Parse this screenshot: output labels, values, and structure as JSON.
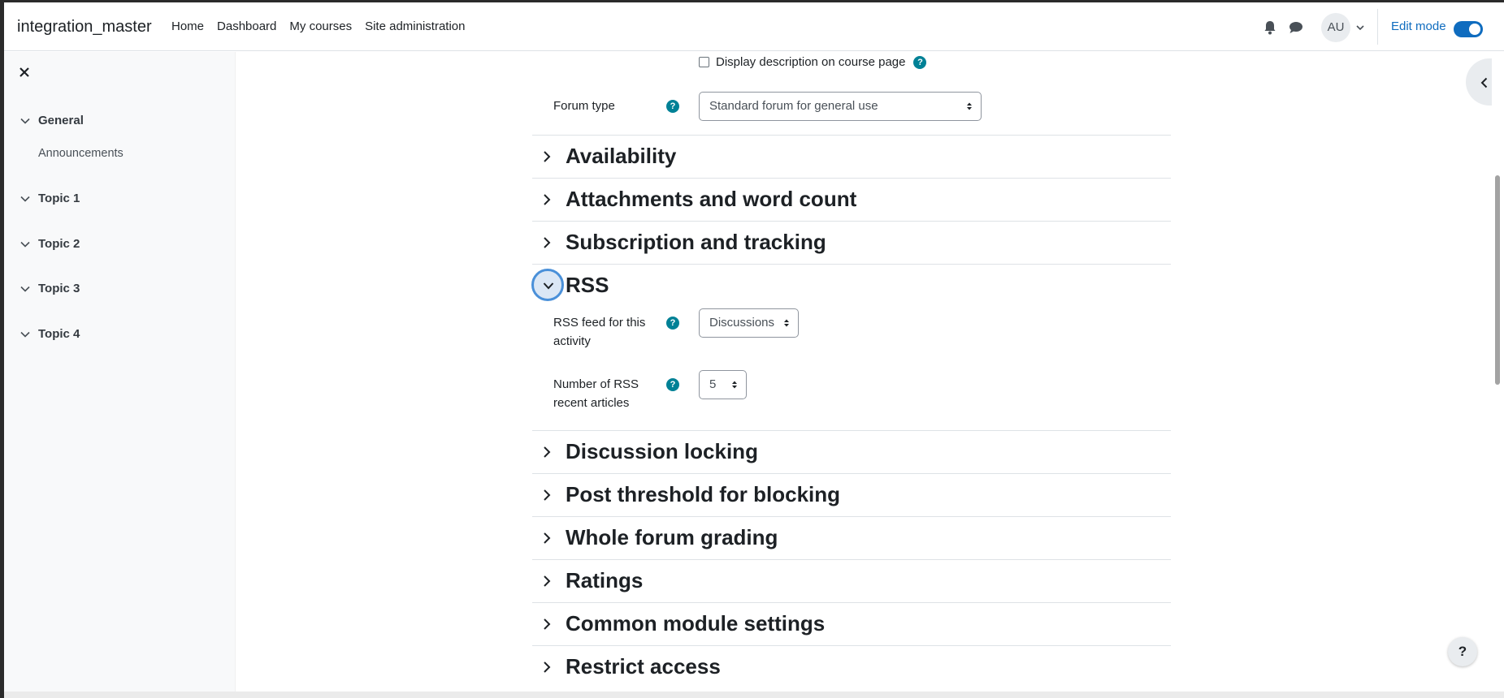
{
  "navbar": {
    "brand": "integration_master",
    "links": [
      "Home",
      "Dashboard",
      "My courses",
      "Site administration"
    ],
    "avatar_initials": "AU",
    "edit_mode_label": "Edit mode",
    "edit_mode_on": true
  },
  "drawer": {
    "sections": [
      {
        "label": "General",
        "items": [
          "Announcements"
        ]
      },
      {
        "label": "Topic 1",
        "items": []
      },
      {
        "label": "Topic 2",
        "items": []
      },
      {
        "label": "Topic 3",
        "items": []
      },
      {
        "label": "Topic 4",
        "items": []
      }
    ]
  },
  "form": {
    "display_description_label": "Display description on course page",
    "display_description_checked": false,
    "forum_type_label": "Forum type",
    "forum_type_value": "Standard forum for general use",
    "rss_feed_label": "RSS feed for this activity",
    "rss_feed_value": "Discussions",
    "rss_articles_label": "Number of RSS recent articles",
    "rss_articles_value": "5",
    "help_glyph": "?"
  },
  "sections": [
    {
      "title": "Availability",
      "expanded": false
    },
    {
      "title": "Attachments and word count",
      "expanded": false
    },
    {
      "title": "Subscription and tracking",
      "expanded": false
    },
    {
      "title": "RSS",
      "expanded": true
    },
    {
      "title": "Discussion locking",
      "expanded": false
    },
    {
      "title": "Post threshold for blocking",
      "expanded": false
    },
    {
      "title": "Whole forum grading",
      "expanded": false
    },
    {
      "title": "Ratings",
      "expanded": false
    },
    {
      "title": "Common module settings",
      "expanded": false
    },
    {
      "title": "Restrict access",
      "expanded": false
    }
  ],
  "help_fab": "?",
  "colors": {
    "brand_blue": "#0f6cbf",
    "help_teal": "#008196"
  }
}
